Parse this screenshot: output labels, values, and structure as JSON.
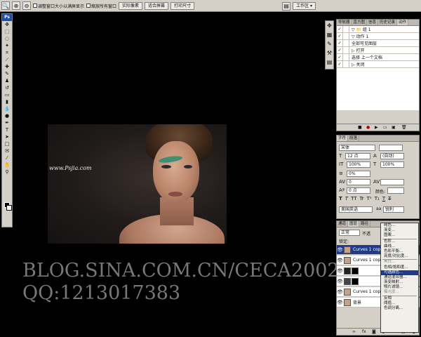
{
  "options_bar": {
    "checkbox_resize": "调整窗口大小以满屏显示",
    "checkbox_zoom_all": "缩放所有窗口",
    "btn_actual_pixels": "实际像素",
    "btn_fit_screen": "适合屏幕",
    "btn_print_size": "打印尺寸",
    "workspace_label": "工作区 ▾"
  },
  "toolbar": {
    "logo": "Ps"
  },
  "canvas": {
    "watermark": "www.Psjia.com"
  },
  "overlay": {
    "line1": "BLOG.SINA.COM.CN/CECA2002",
    "line2": "QQ:1213017383"
  },
  "actions_panel": {
    "tabs": [
      "导航器",
      "直方图",
      "信息",
      "历史记录",
      "动作"
    ],
    "rows": [
      {
        "check": "✓",
        "toggle": "",
        "label": "▽ 📁 组 1"
      },
      {
        "check": "✓",
        "toggle": "",
        "label": "  ▽ 动作 1"
      },
      {
        "check": "✓",
        "toggle": "",
        "label": "      全部可见图层"
      },
      {
        "check": "✓",
        "toggle": "",
        "label": "    ▷ 打开"
      },
      {
        "check": "✓",
        "toggle": "",
        "label": "      选择 上一个文档"
      },
      {
        "check": "✓",
        "toggle": "",
        "label": "    ▷ 关闭"
      }
    ]
  },
  "character_panel": {
    "tabs": [
      "字符",
      "段落"
    ],
    "font_family": "宋体",
    "font_size": "12 点",
    "leading": "(自动)",
    "vscale": "100%",
    "hscale": "100%",
    "tracking": "0%",
    "kerning": "0",
    "baseline": "0 点",
    "color_label": "颜色:",
    "language": "美国英语",
    "antialias": "锐利",
    "styles": [
      "T",
      "T",
      "TT",
      "Tr",
      "T¹",
      "T₁",
      "T",
      "T"
    ]
  },
  "layers_panel": {
    "tabs": [
      "通道",
      "图层",
      "路径"
    ],
    "blend": "正常",
    "opacity_label": "不透",
    "lock_label": "锁定:",
    "layers": [
      {
        "name": "Curves 1 cop",
        "selected": true
      },
      {
        "name": "Curves 1 cop",
        "selected": false
      },
      {
        "name": "",
        "selected": false
      },
      {
        "name": "",
        "selected": false
      },
      {
        "name": "Curves 1 cop",
        "selected": false
      },
      {
        "name": "背景",
        "selected": false
      }
    ]
  },
  "adjust_menu": {
    "items": [
      {
        "label": "纯色...",
        "state": "normal"
      },
      {
        "label": "渐变...",
        "state": "normal"
      },
      {
        "label": "图案...",
        "state": "normal"
      },
      {
        "label": "-",
        "state": "sep"
      },
      {
        "label": "色阶...",
        "state": "normal"
      },
      {
        "label": "曲线...",
        "state": "normal"
      },
      {
        "label": "色彩平衡...",
        "state": "normal"
      },
      {
        "label": "亮度/对比度...",
        "state": "normal"
      },
      {
        "label": "-",
        "state": "sep"
      },
      {
        "label": "黑白...",
        "state": "disabled"
      },
      {
        "label": "色相/饱和度...",
        "state": "normal"
      },
      {
        "label": "可选颜色...",
        "state": "highlight"
      },
      {
        "label": "通道混合器...",
        "state": "normal"
      },
      {
        "label": "渐变映射...",
        "state": "normal"
      },
      {
        "label": "照片滤镜...",
        "state": "normal"
      },
      {
        "label": "曝光度...",
        "state": "disabled"
      },
      {
        "label": "-",
        "state": "sep"
      },
      {
        "label": "反相",
        "state": "normal"
      },
      {
        "label": "阈值...",
        "state": "normal"
      },
      {
        "label": "色调分离...",
        "state": "normal"
      }
    ]
  }
}
